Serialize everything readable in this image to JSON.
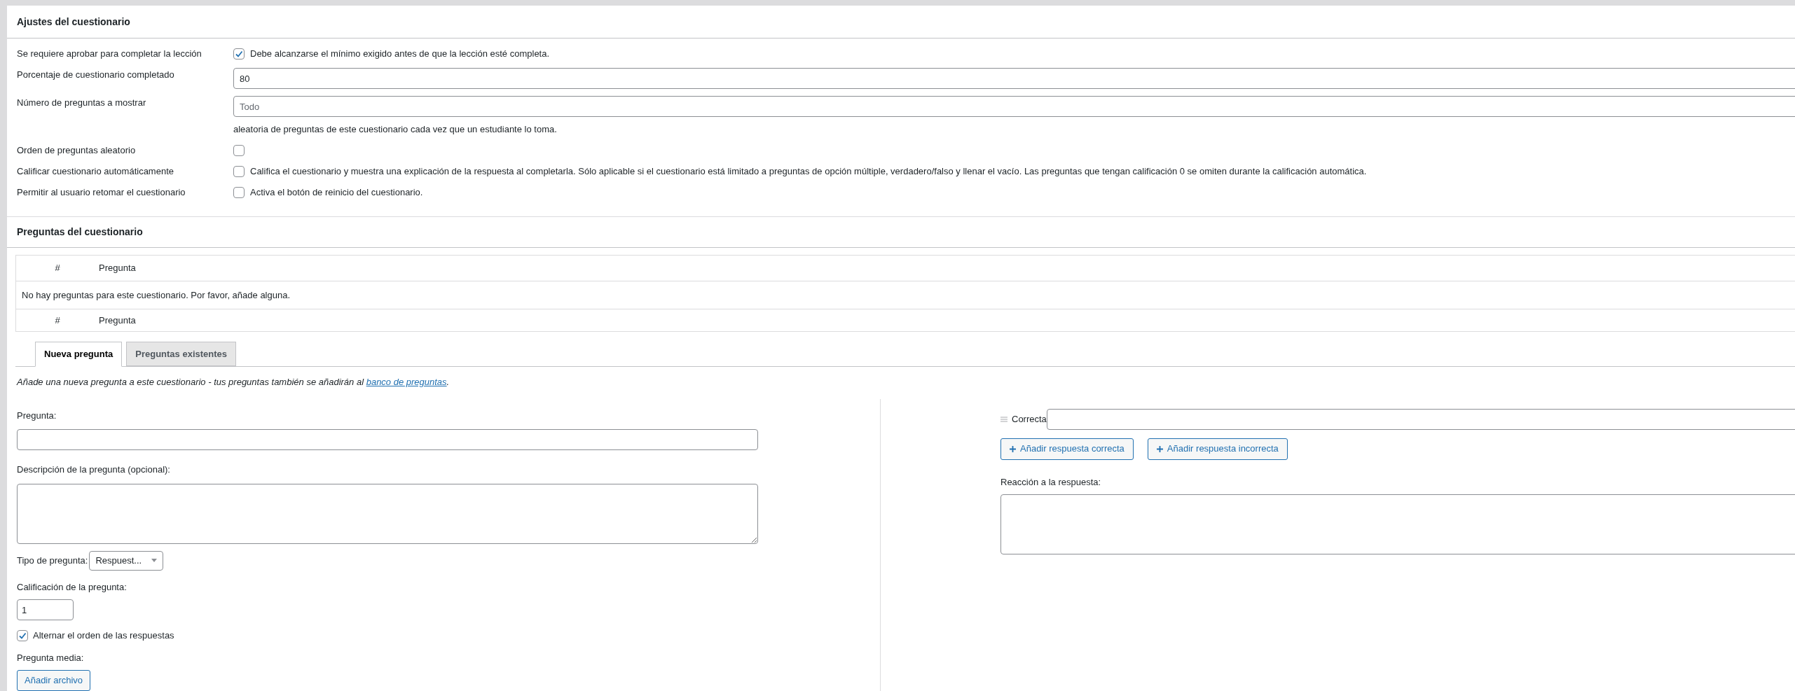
{
  "settings": {
    "title": "Ajustes del cuestionario",
    "rows": [
      {
        "label": "Se requiere aprobar para completar la lección",
        "kind": "checkbox",
        "checked": true,
        "text": "Debe alcanzarse el mínimo exigido antes de que la lección esté completa."
      },
      {
        "label": "Porcentaje de cuestionario completado",
        "kind": "input",
        "value": "80"
      },
      {
        "label": "Número de preguntas a mostrar",
        "kind": "input",
        "placeholder": "Todo",
        "help": "aleatoria de preguntas de este cuestionario cada vez que un estudiante lo toma."
      },
      {
        "label": "Orden de preguntas aleatorio",
        "kind": "checkbox",
        "checked": false
      },
      {
        "label": "Calificar cuestionario automáticamente",
        "kind": "checkbox",
        "checked": false,
        "text": "Califica el cuestionario y muestra una explicación de la respuesta al completarla. Sólo aplicable si el cuestionario está limitado a preguntas de opción múltiple, verdadero/falso y llenar el vacío. Las preguntas que tengan calificación 0 se omiten durante la calificación automática."
      },
      {
        "label": "Permitir al usuario retomar el cuestionario",
        "kind": "checkbox",
        "checked": false,
        "text": "Activa el botón de reinicio del cuestionario."
      }
    ]
  },
  "questions": {
    "title": "Preguntas del cuestionario",
    "table": {
      "columns": [
        "#",
        "Pregunta"
      ],
      "empty_message": "No hay preguntas para este cuestionario. Por favor, añade alguna.",
      "footer_columns": [
        "#",
        "Pregunta"
      ]
    },
    "tabs": [
      {
        "label": "Nueva pregunta",
        "selected": true
      },
      {
        "label": "Preguntas existentes",
        "selected": false
      }
    ],
    "intro": {
      "text": "Añade una nueva pregunta a este cuestionario - tus preguntas también se añadirán al ",
      "link": "banco de preguntas",
      "suffix": "."
    },
    "form": {
      "question_label": "Pregunta:",
      "description_label": "Descripción de la pregunta (opcional):",
      "type_label": "Tipo de pregunta:",
      "type_value": "Respuest...",
      "grade_label": "Calificación de la pregunta:",
      "grade_value": "1",
      "shuffle": {
        "label": "Alternar el orden de las respuestas",
        "checked": true
      },
      "media_label": "Pregunta media:",
      "media_button": "Añadir archivo"
    },
    "answers": {
      "rows": [
        {
          "label": "Correcta"
        }
      ],
      "buttons": [
        "Añadir respuesta correcta",
        "Añadir respuesta incorrecta"
      ],
      "feedback_label": "Reacción a la respuesta:"
    }
  }
}
